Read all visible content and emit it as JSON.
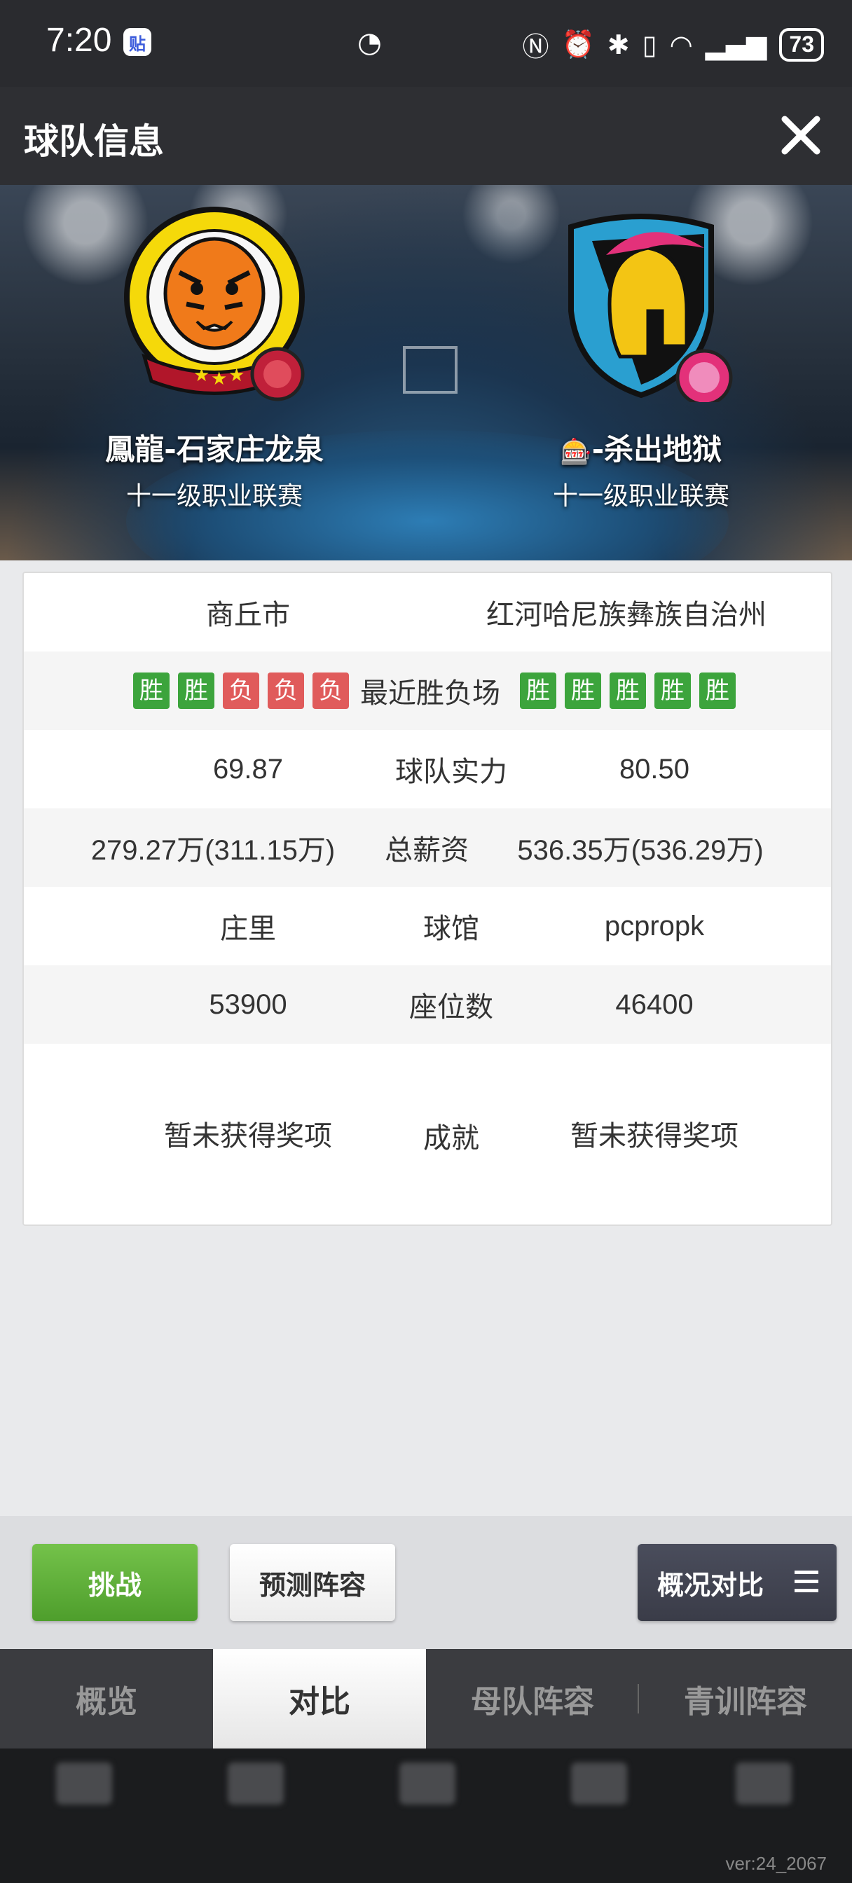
{
  "status_bar": {
    "time": "7:20",
    "app_badge": "贴",
    "battery": "73"
  },
  "header": {
    "title": "球队信息"
  },
  "teams": {
    "left": {
      "name": "鳳龍-石家庄龙泉",
      "league": "十一级职业联赛"
    },
    "right": {
      "name": "-杀出地狱",
      "league": "十一级职业联赛"
    }
  },
  "compare": {
    "city": {
      "left": "商丘市",
      "right": "红河哈尼族彝族自治州"
    },
    "recent": {
      "label": "最近胜负场",
      "left": [
        "胜",
        "胜",
        "负",
        "负",
        "负"
      ],
      "right": [
        "胜",
        "胜",
        "胜",
        "胜",
        "胜"
      ]
    },
    "strength": {
      "label": "球队实力",
      "left": "69.87",
      "right": "80.50"
    },
    "salary": {
      "label": "总薪资",
      "left": "279.27万(311.15万)",
      "right": "536.35万(536.29万)"
    },
    "arena": {
      "label": "球馆",
      "left": "庄里",
      "right": "pcpropk"
    },
    "seats": {
      "label": "座位数",
      "left": "53900",
      "right": "46400"
    },
    "achievements": {
      "label": "成就",
      "left": "暂未获得奖项",
      "right": "暂未获得奖项"
    }
  },
  "actions": {
    "challenge": "挑战",
    "predict": "预测阵容",
    "compare_menu": "概况对比"
  },
  "tabs": [
    "概览",
    "对比",
    "母队阵容",
    "青训阵容"
  ],
  "active_tab": "对比",
  "footer": {
    "version": "ver:24_2067"
  },
  "colors": {
    "win": "#3ca43c",
    "lose": "#e05b5b",
    "challenge_button": "#5fb03a",
    "header_bg": "#2e2f33"
  }
}
